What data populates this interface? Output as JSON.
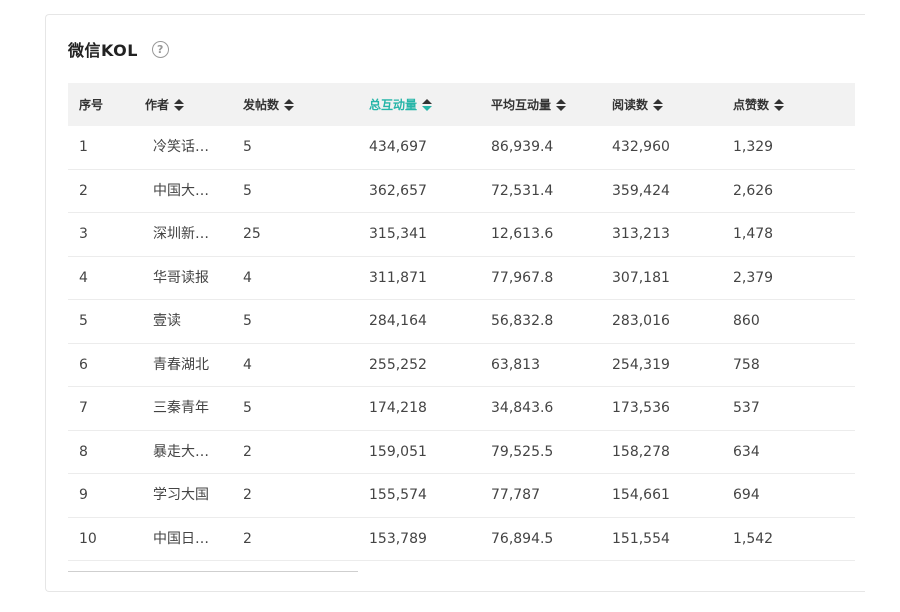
{
  "card": {
    "title": "微信KOL",
    "help_icon": "question-circle-icon"
  },
  "table": {
    "columns": [
      {
        "label": "序号",
        "sortable": false,
        "active": false
      },
      {
        "label": "作者",
        "sortable": true,
        "active": false
      },
      {
        "label": "发帖数",
        "sortable": true,
        "active": false
      },
      {
        "label": "总互动量",
        "sortable": true,
        "active": true
      },
      {
        "label": "平均互动量",
        "sortable": true,
        "active": false
      },
      {
        "label": "阅读数",
        "sortable": true,
        "active": false
      },
      {
        "label": "点赞数",
        "sortable": true,
        "active": false
      }
    ],
    "rows": [
      [
        "1",
        "冷笑话…",
        "5",
        "434,697",
        "86,939.4",
        "432,960",
        "1,329"
      ],
      [
        "2",
        "中国大…",
        "5",
        "362,657",
        "72,531.4",
        "359,424",
        "2,626"
      ],
      [
        "3",
        "深圳新…",
        "25",
        "315,341",
        "12,613.6",
        "313,213",
        "1,478"
      ],
      [
        "4",
        "华哥读报",
        "4",
        "311,871",
        "77,967.8",
        "307,181",
        "2,379"
      ],
      [
        "5",
        "壹读",
        "5",
        "284,164",
        "56,832.8",
        "283,016",
        "860"
      ],
      [
        "6",
        "青春湖北",
        "4",
        "255,252",
        "63,813",
        "254,319",
        "758"
      ],
      [
        "7",
        "三秦青年",
        "5",
        "174,218",
        "34,843.6",
        "173,536",
        "537"
      ],
      [
        "8",
        "暴走大…",
        "2",
        "159,051",
        "79,525.5",
        "158,278",
        "634"
      ],
      [
        "9",
        "学习大国",
        "2",
        "155,574",
        "77,787",
        "154,661",
        "694"
      ],
      [
        "10",
        "中国日…",
        "2",
        "153,789",
        "76,894.5",
        "151,554",
        "1,542"
      ]
    ]
  },
  "colors": {
    "active_sort": "#26b5a8",
    "header_bg": "#f2f2f2"
  }
}
